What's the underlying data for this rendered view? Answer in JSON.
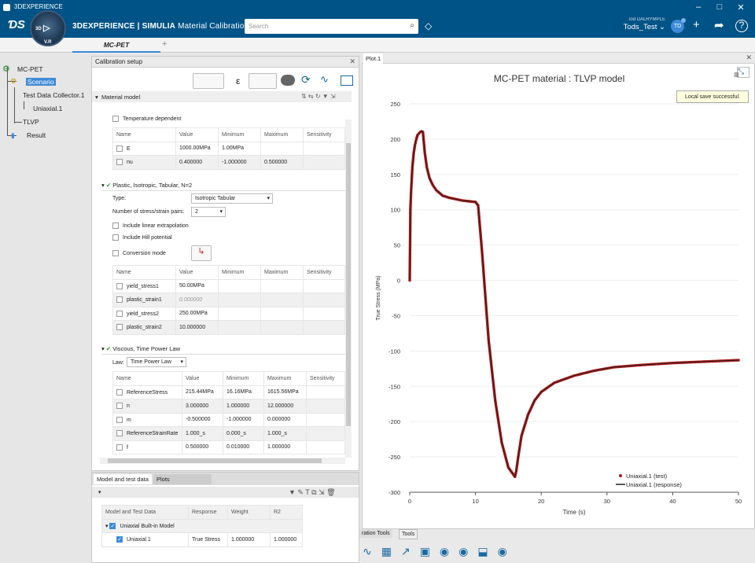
{
  "window": {
    "title": "3DEXPERIENCE"
  },
  "app": {
    "brand_bold": "3DEXPERIENCE | SIMULIA",
    "brand_app": "Material Calibration",
    "compass_v": "V.R",
    "compass_3d": "3D"
  },
  "search": {
    "placeholder": "Search"
  },
  "user": {
    "subtitle": "Tod DALRYMPLE",
    "name": "Tods_Test",
    "initials": "TD"
  },
  "tabs": {
    "active": "MC-PET",
    "add": "+"
  },
  "tree": {
    "root": "MC-PET",
    "scenario": "Scenario",
    "collector": "Test Data Collector.1",
    "uniaxial": "Uniaxial.1",
    "model": "TLVP",
    "result": "Result"
  },
  "calibration": {
    "title": "Calibration setup",
    "material_model": "Material model",
    "temperature_dependent": "Temperature dependent",
    "columns": [
      "Name",
      "Value",
      "Minimum",
      "Maximum",
      "Sensitivity"
    ],
    "elastic_rows": [
      {
        "name": "E",
        "value": "1000.00MPa",
        "min": "1.00MPa",
        "max": ""
      },
      {
        "name": "nu",
        "value": "0.400000",
        "min": "-1.000000",
        "max": "0.500000"
      }
    ],
    "plastic_title": "Plastic, Isotropic, Tabular, N=2",
    "type_label": "Type:",
    "type_value": "Isotropic Tabular",
    "pairs_label": "Number of stress/strain pairs:",
    "pairs_value": "2",
    "linear_extrapolation": "Include linear extrapolation",
    "hill_potential": "Include Hill potential",
    "conversion_mode": "Conversion mode",
    "plastic_rows": [
      {
        "name": "yield_stress1",
        "value": "50.00MPa"
      },
      {
        "name": "plastic_strain1",
        "value": "0.000000"
      },
      {
        "name": "yield_stress2",
        "value": "250.00MPa"
      },
      {
        "name": "plastic_strain2",
        "value": "10.000000"
      }
    ],
    "viscous_title": "Viscous, Time Power Law",
    "law_label": "Law:",
    "law_value": "Time Power Law",
    "viscous_rows": [
      {
        "name": "ReferenceStress",
        "value": "215.44MPa",
        "min": "16.16MPa",
        "max": "1615.56MPa"
      },
      {
        "name": "n",
        "value": "3.000000",
        "min": "1.000000",
        "max": "12.000000"
      },
      {
        "name": "m",
        "value": "-0.500000",
        "min": "-1.000000",
        "max": "0.000000"
      },
      {
        "name": "ReferenceStrainRate",
        "value": "1.000_s",
        "min": "0.000_s",
        "max": "1.000_s"
      },
      {
        "name": "f",
        "value": "0.500000",
        "min": "0.010000",
        "max": "1.000000"
      }
    ]
  },
  "bottom": {
    "tab1": "Model and test data",
    "tab2": "Plots",
    "columns": [
      "Model and Test Data",
      "Response",
      "Weight",
      "R2"
    ],
    "group": "Uniaxial Built-in Model",
    "row": {
      "name": "Uniaxial.1",
      "response": "True Stress",
      "weight": "1.000000",
      "r2": "1.000000"
    }
  },
  "plot": {
    "tab": "Plot.1",
    "toast": "Local save successful."
  },
  "tools": {
    "tab1": "ration Tools",
    "tab2": "Tools"
  },
  "chart_data": {
    "type": "line",
    "title": "MC-PET material : TLVP model",
    "xlabel": "Time (s)",
    "ylabel": "True Stress (MPa)",
    "xlim": [
      0,
      50
    ],
    "ylim": [
      -300,
      250
    ],
    "xticks": [
      0,
      10,
      20,
      30,
      40,
      50
    ],
    "yticks": [
      -300,
      -250,
      -200,
      -150,
      -100,
      -50,
      0,
      50,
      100,
      150,
      200,
      250
    ],
    "legend_position": "bottom-right",
    "series": [
      {
        "name": "Uniaxial.1 (test)",
        "color": "#b01818",
        "style": "markers",
        "x": [
          0,
          0.1,
          0.2,
          0.4,
          0.6,
          0.8,
          1.0,
          1.2,
          1.4,
          1.6,
          1.8,
          2.0,
          2.3,
          2.6,
          3,
          3.5,
          4,
          5,
          6,
          7,
          8,
          9,
          10,
          10.4,
          11,
          12,
          13,
          14,
          15,
          16,
          16.2,
          16.5,
          17,
          18,
          19,
          20,
          22,
          25,
          28,
          31,
          35,
          40,
          45,
          50
        ],
        "y": [
          0,
          100,
          125,
          160,
          180,
          192,
          200,
          206,
          208,
          210,
          211,
          210,
          180,
          160,
          145,
          135,
          128,
          120,
          117,
          115,
          113,
          112,
          111,
          106,
          40,
          -85,
          -170,
          -230,
          -265,
          -278,
          -270,
          -250,
          -220,
          -190,
          -170,
          -158,
          -145,
          -135,
          -128,
          -123,
          -120,
          -117,
          -115,
          -113
        ]
      },
      {
        "name": "Uniaxial.1 (response)",
        "color": "#222222",
        "style": "line",
        "x": [
          0,
          0.1,
          0.2,
          0.4,
          0.6,
          0.8,
          1.0,
          1.2,
          1.4,
          1.6,
          1.8,
          2.0,
          2.3,
          2.6,
          3,
          3.5,
          4,
          5,
          6,
          7,
          8,
          9,
          10,
          10.4,
          11,
          12,
          13,
          14,
          15,
          16,
          16.2,
          16.5,
          17,
          18,
          19,
          20,
          22,
          25,
          28,
          31,
          35,
          40,
          45,
          50
        ],
        "y": [
          0,
          100,
          125,
          160,
          180,
          192,
          200,
          206,
          208,
          210,
          211,
          210,
          180,
          160,
          145,
          135,
          128,
          120,
          117,
          115,
          113,
          112,
          111,
          106,
          40,
          -85,
          -170,
          -230,
          -265,
          -278,
          -270,
          -250,
          -220,
          -190,
          -170,
          -158,
          -145,
          -135,
          -128,
          -123,
          -120,
          -117,
          -115,
          -113
        ]
      }
    ]
  }
}
